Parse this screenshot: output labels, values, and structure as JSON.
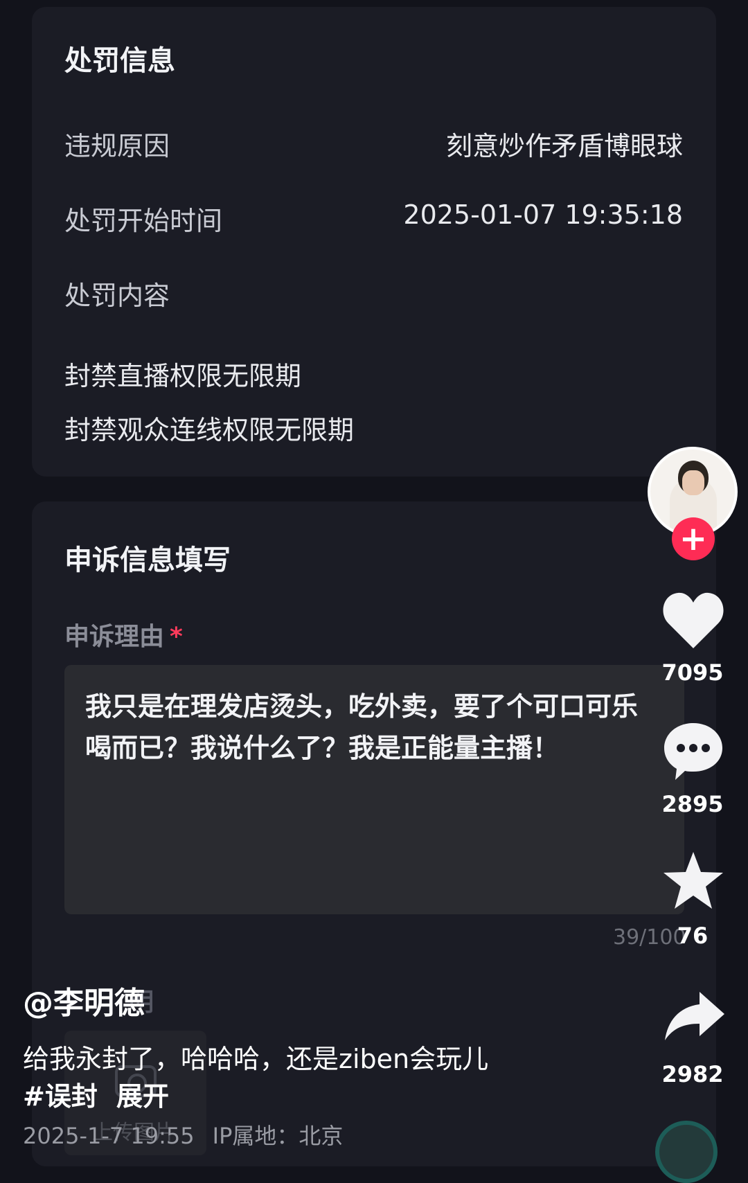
{
  "penalty": {
    "title": "处罚信息",
    "reason_label": "违规原因",
    "reason_value": "刻意炒作矛盾博眼球",
    "start_label": "处罚开始时间",
    "start_value": "2025-01-07 19:35:18",
    "content_label": "处罚内容",
    "content_lines": [
      "封禁直播权限无限期",
      "封禁观众连线权限无限期"
    ]
  },
  "appeal": {
    "title": "申诉信息填写",
    "reason_label": "申诉理由",
    "required_mark": "*",
    "reason_text": "我只是在理发店烫头，吃外卖，要了个可口可乐喝而已？我说什么了？我是正能量主播！",
    "char_count": "39/100",
    "partial_label": "明",
    "upload_label": "上传图片"
  },
  "rail": {
    "follow_symbol": "+",
    "likes": "7095",
    "comments": "2895",
    "favorites": "76",
    "shares": "2982"
  },
  "post": {
    "author": "@李明德",
    "caption": "给我永封了，哈哈哈，还是ziben会玩儿",
    "hashtag": "#误封",
    "expand": "展开",
    "date": "2025-1-7 19:55",
    "ip": "IP属地：北京"
  },
  "colors": {
    "background": "#12131b",
    "card": "#1b1c25",
    "accent": "#fe2c55"
  }
}
